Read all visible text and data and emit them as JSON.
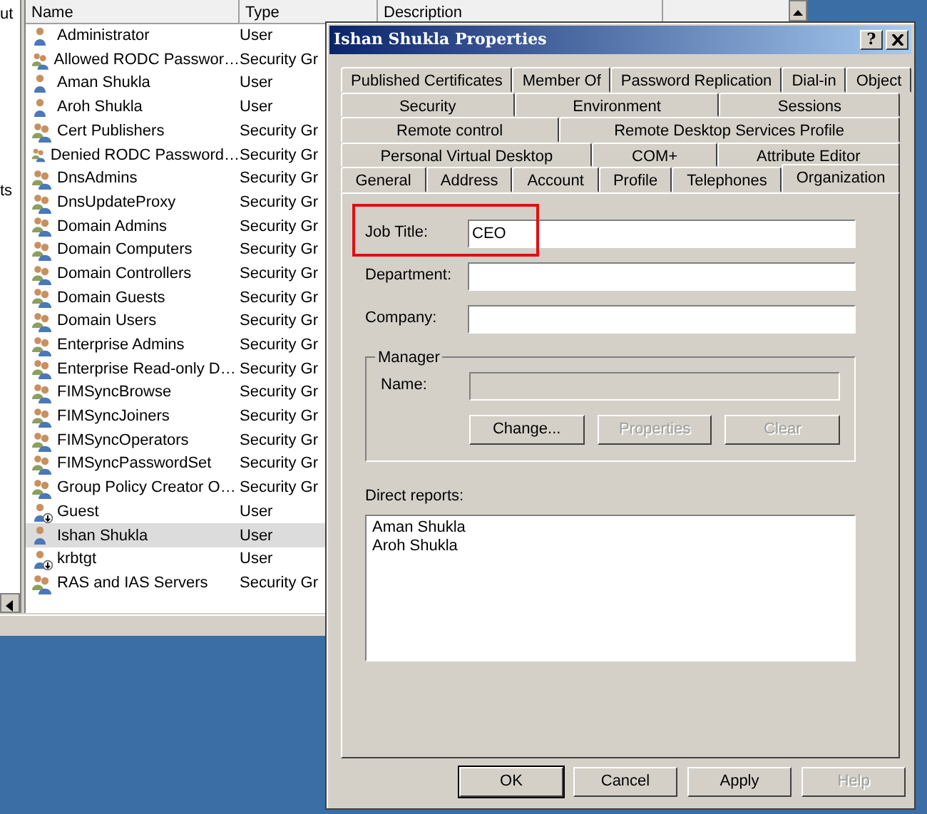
{
  "background_window": {
    "tree_items": [
      "ut",
      "ts"
    ],
    "columns": [
      "Name",
      "Type",
      "Description"
    ],
    "rows": [
      {
        "name": "Administrator",
        "type": "User",
        "kind": "user",
        "selected": false
      },
      {
        "name": "Allowed RODC Passwor…",
        "type": "Security Gr",
        "kind": "group",
        "selected": false
      },
      {
        "name": "Aman Shukla",
        "type": "User",
        "kind": "user",
        "selected": false
      },
      {
        "name": "Aroh Shukla",
        "type": "User",
        "kind": "user",
        "selected": false
      },
      {
        "name": "Cert Publishers",
        "type": "Security Gr",
        "kind": "group",
        "selected": false
      },
      {
        "name": "Denied RODC Password…",
        "type": "Security Gr",
        "kind": "group",
        "selected": false
      },
      {
        "name": "DnsAdmins",
        "type": "Security Gr",
        "kind": "group",
        "selected": false
      },
      {
        "name": "DnsUpdateProxy",
        "type": "Security Gr",
        "kind": "group",
        "selected": false
      },
      {
        "name": "Domain Admins",
        "type": "Security Gr",
        "kind": "group",
        "selected": false
      },
      {
        "name": "Domain Computers",
        "type": "Security Gr",
        "kind": "group",
        "selected": false
      },
      {
        "name": "Domain Controllers",
        "type": "Security Gr",
        "kind": "group",
        "selected": false
      },
      {
        "name": "Domain Guests",
        "type": "Security Gr",
        "kind": "group",
        "selected": false
      },
      {
        "name": "Domain Users",
        "type": "Security Gr",
        "kind": "group",
        "selected": false
      },
      {
        "name": "Enterprise Admins",
        "type": "Security Gr",
        "kind": "group",
        "selected": false
      },
      {
        "name": "Enterprise Read-only D…",
        "type": "Security Gr",
        "kind": "group",
        "selected": false
      },
      {
        "name": "FIMSyncBrowse",
        "type": "Security Gr",
        "kind": "group",
        "selected": false
      },
      {
        "name": "FIMSyncJoiners",
        "type": "Security Gr",
        "kind": "group",
        "selected": false
      },
      {
        "name": "FIMSyncOperators",
        "type": "Security Gr",
        "kind": "group",
        "selected": false
      },
      {
        "name": "FIMSyncPasswordSet",
        "type": "Security Gr",
        "kind": "group",
        "selected": false
      },
      {
        "name": "Group Policy Creator O…",
        "type": "Security Gr",
        "kind": "group",
        "selected": false
      },
      {
        "name": "Guest",
        "type": "User",
        "kind": "disabled-user",
        "selected": false
      },
      {
        "name": "Ishan Shukla",
        "type": "User",
        "kind": "user",
        "selected": true
      },
      {
        "name": "krbtgt",
        "type": "User",
        "kind": "disabled-user",
        "selected": false
      },
      {
        "name": "RAS and IAS Servers",
        "type": "Security Gr",
        "kind": "group",
        "selected": false
      }
    ]
  },
  "dialog": {
    "title": "Ishan Shukla Properties",
    "help_button": "?",
    "tab_rows": [
      {
        "tabs": [
          {
            "label": "Published Certificates",
            "selected": false
          },
          {
            "label": "Member Of",
            "selected": false
          },
          {
            "label": "Password Replication",
            "selected": false
          },
          {
            "label": "Dial-in",
            "selected": false
          },
          {
            "label": "Object",
            "selected": false
          }
        ]
      },
      {
        "tabs": [
          {
            "label": "Security",
            "selected": false
          },
          {
            "label": "Environment",
            "selected": false
          },
          {
            "label": "Sessions",
            "selected": false
          }
        ]
      },
      {
        "tabs": [
          {
            "label": "Remote control",
            "selected": false
          },
          {
            "label": "Remote Desktop Services Profile",
            "selected": false
          }
        ]
      },
      {
        "tabs": [
          {
            "label": "Personal Virtual Desktop",
            "selected": false
          },
          {
            "label": "COM+",
            "selected": false
          },
          {
            "label": "Attribute Editor",
            "selected": false
          }
        ]
      },
      {
        "tabs": [
          {
            "label": "General",
            "selected": false
          },
          {
            "label": "Address",
            "selected": false
          },
          {
            "label": "Account",
            "selected": false
          },
          {
            "label": "Profile",
            "selected": false
          },
          {
            "label": "Telephones",
            "selected": false
          },
          {
            "label": "Organization",
            "selected": true
          }
        ]
      }
    ],
    "fields": [
      {
        "label": "Job Title:",
        "value": "CEO",
        "highlighted": true
      },
      {
        "label": "Department:",
        "highlighted": false
      },
      {
        "label": "Company:",
        "highlighted": false
      }
    ],
    "manager": {
      "title": "Manager",
      "name_label": "Name:",
      "name_disabled": true,
      "buttons": [
        {
          "label": "Change...",
          "disabled": false
        },
        {
          "label": "Properties",
          "disabled": true
        },
        {
          "label": "Clear",
          "disabled": true
        }
      ]
    },
    "direct_reports": {
      "label": "Direct reports:",
      "items": [
        "Aman Shukla",
        "Aroh Shukla"
      ]
    },
    "buttons": [
      {
        "label": "OK",
        "disabled": false
      },
      {
        "label": "Cancel",
        "disabled": false
      },
      {
        "label": "Apply",
        "disabled": false
      },
      {
        "label": "Help",
        "disabled": true
      }
    ]
  }
}
